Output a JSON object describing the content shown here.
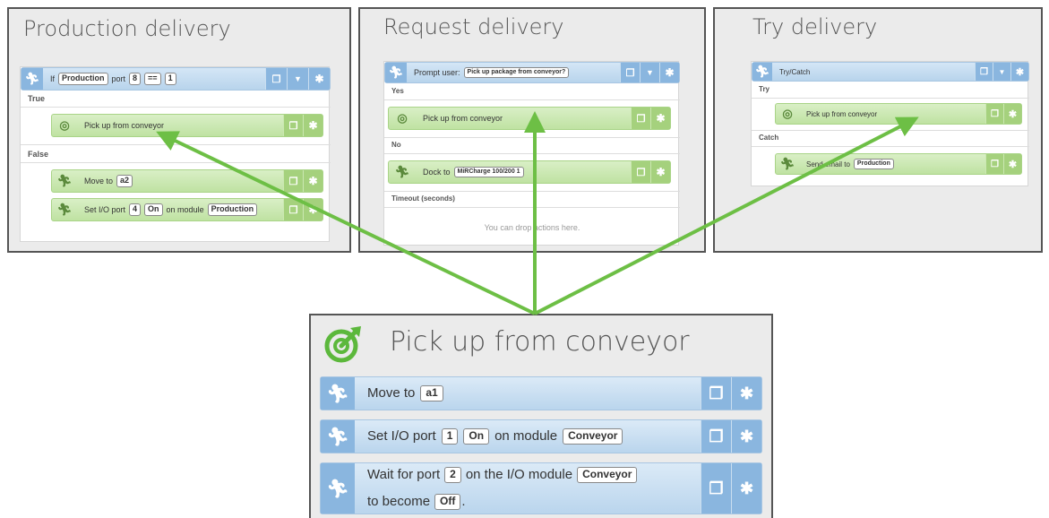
{
  "panels": {
    "production": {
      "title": "Production delivery",
      "if_row": {
        "if": "If",
        "chip1": "Production",
        "port": "port",
        "chip2": "8",
        "chip3": "==",
        "chip4": "1"
      },
      "true_label": "True",
      "pick_up": "Pick up from conveyor",
      "false_label": "False",
      "move_to": "Move to",
      "move_chip": "a2",
      "set_io": {
        "prefix": "Set I/O port",
        "chip1": "4",
        "chip2": "On",
        "mid": "on module",
        "chip3": "Production"
      }
    },
    "request": {
      "title": "Request delivery",
      "prompt": {
        "prefix": "Prompt user:",
        "chip": "Pick up package from conveyor?"
      },
      "yes_label": "Yes",
      "pick_up": "Pick up from conveyor",
      "no_label": "No",
      "dock": {
        "prefix": "Dock to",
        "chip": "MiRCharge 100/200 1"
      },
      "timeout_label": "Timeout (seconds)",
      "placeholder": "You can drop actions here."
    },
    "try": {
      "title": "Try delivery",
      "try_catch": "Try/Catch",
      "try_label": "Try",
      "pick_up": "Pick up from conveyor",
      "catch_label": "Catch",
      "send_email": {
        "prefix": "Send email to",
        "chip": "Production"
      }
    }
  },
  "detail": {
    "title": "Pick up from conveyor",
    "rows": [
      {
        "prefix": "Move to",
        "chip1": "a1"
      },
      {
        "prefix": "Set I/O port",
        "chip1": "1",
        "chip2": "On",
        "mid": "on module",
        "chip3": "Conveyor"
      },
      {
        "prefix": "Wait for port",
        "chip1": "2",
        "mid": "on the I/O module",
        "chip2": "Conveyor",
        "suffix": "to become",
        "chip3": "Off",
        "end": "."
      }
    ]
  },
  "icons": {
    "walk": "running-figure-icon",
    "target": "target-icon",
    "copy": "copy-icon",
    "gear": "gear-icon",
    "caret": "chevron-down-icon"
  },
  "colors": {
    "arrow": "#6dbf45",
    "blue_row": "#c4dcf1",
    "green_row": "#c9e7b0",
    "target_icon": "#5cb83c"
  }
}
